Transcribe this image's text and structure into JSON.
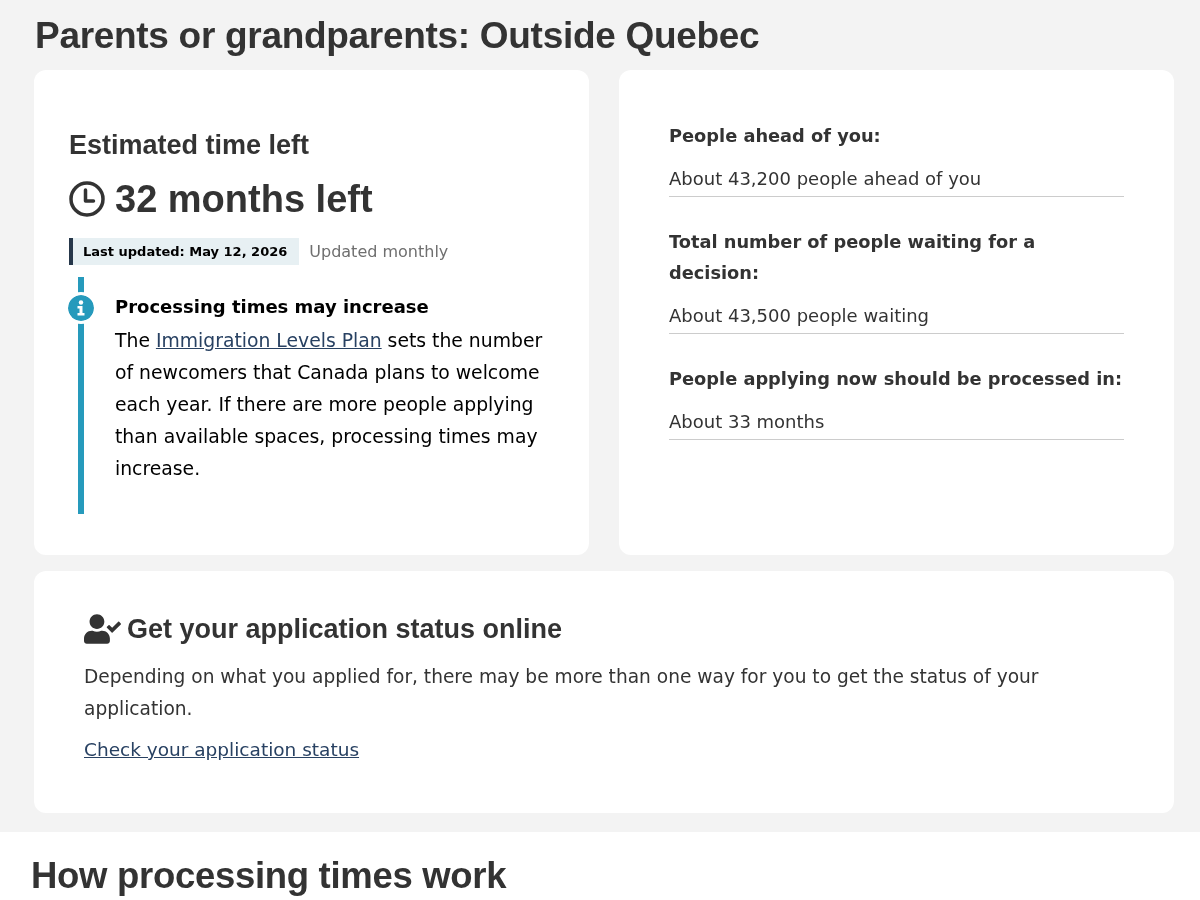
{
  "page_title": "Parents or grandparents: Outside Quebec",
  "estimate_card": {
    "heading": "Estimated time left",
    "time_left": "32 months left",
    "last_updated": "Last updated: May 12, 2026",
    "update_frequency": "Updated monthly",
    "alert": {
      "kind": "info",
      "title": "Processing times may increase",
      "body": [
        {
          "kind": "text",
          "text": "The "
        },
        {
          "kind": "link",
          "text": "Immigration Levels Plan"
        },
        {
          "kind": "text",
          "text": " sets the number of newcomers that Canada plans to welcome each year. If there are more people applying than available spaces, processing times may increase."
        }
      ]
    }
  },
  "stats_card": {
    "items": [
      {
        "label": "People ahead of you:",
        "value": "About 43,200 people ahead of you"
      },
      {
        "label": "Total number of people waiting for a decision:",
        "value": "About 43,500 people waiting"
      },
      {
        "label": "People applying now should be processed in:",
        "value": "About 33 months"
      }
    ]
  },
  "status_card": {
    "heading": "Get your application status online",
    "text": "Depending on what you applied for, there may be more than one way for you to get the status of your application.",
    "link": "Check your application status"
  },
  "next_section": {
    "heading": "How processing times work"
  }
}
